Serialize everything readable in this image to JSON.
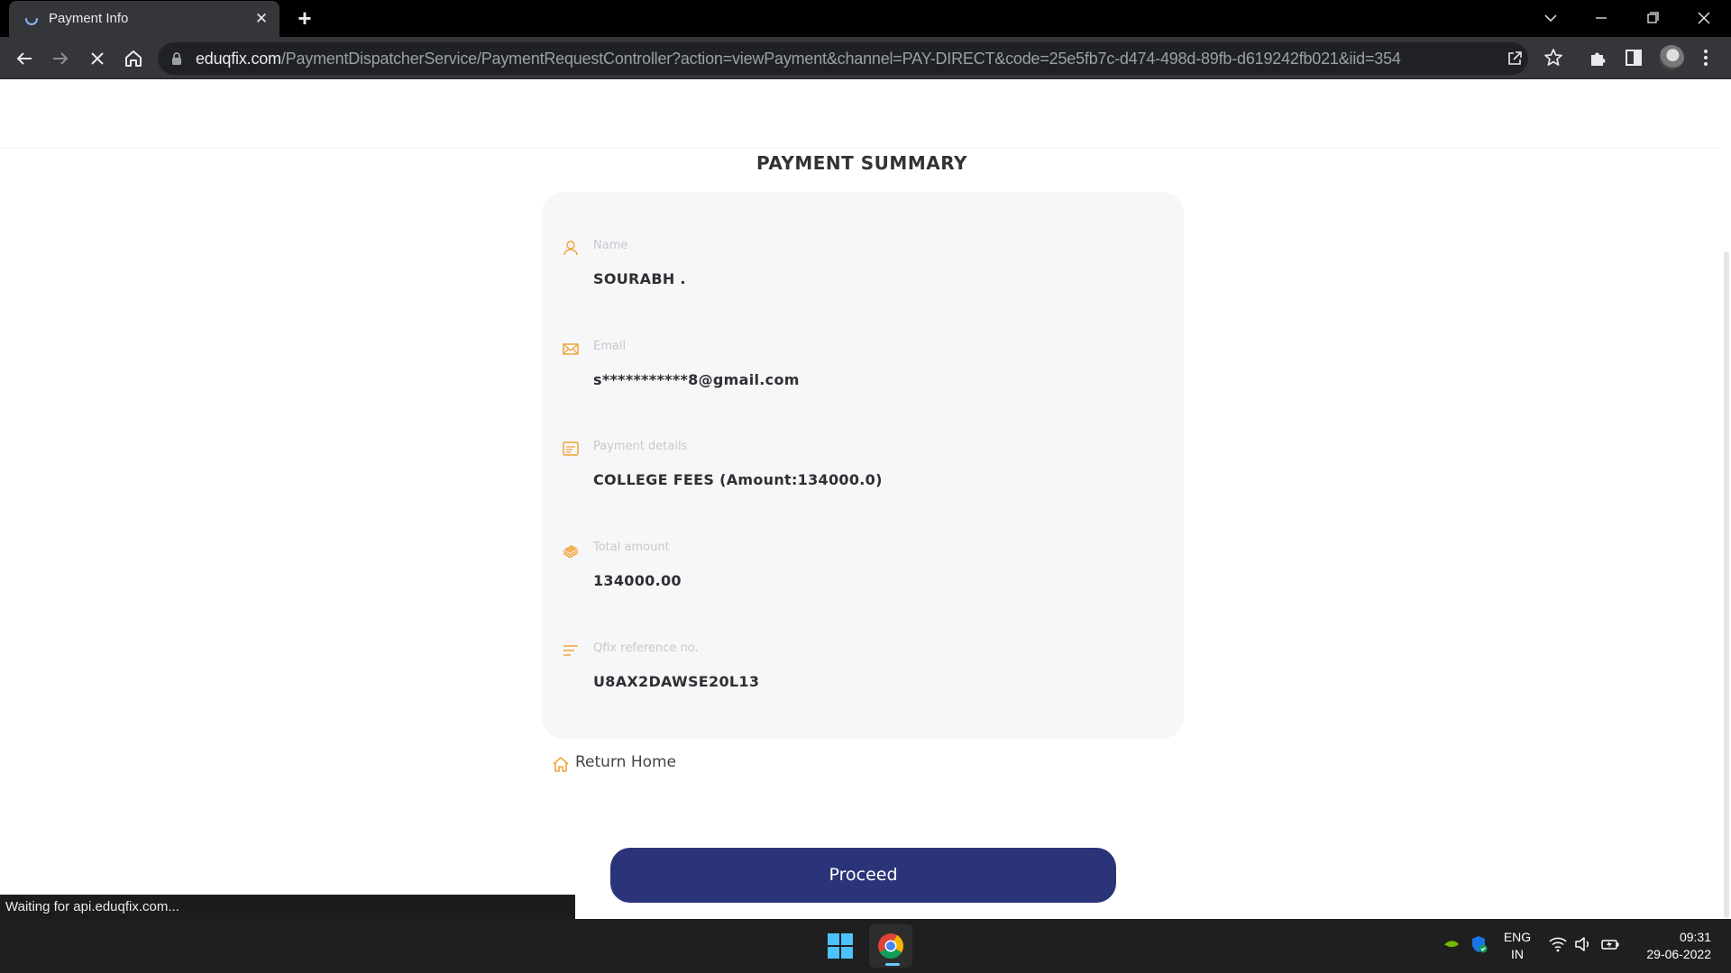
{
  "browser": {
    "tab_title": "Payment Info",
    "tab_close": "✕",
    "new_tab": "+",
    "url_host": "eduqfix.com",
    "url_path": "/PaymentDispatcherService/PaymentRequestController?action=viewPayment&channel=PAY-DIRECT&code=25e5fb7c-d474-498d-89fb-d619242fb021&iid=354",
    "status_text": "Waiting for api.eduqfix.com..."
  },
  "page": {
    "title": "PAYMENT SUMMARY",
    "fields": [
      {
        "label": "Name",
        "value": "SOURABH .",
        "icon": "user-icon"
      },
      {
        "label": "Email",
        "value": "s***********8@gmail.com",
        "icon": "mail-icon"
      },
      {
        "label": "Payment details",
        "value": "COLLEGE FEES (Amount:134000.0)",
        "icon": "details-icon"
      },
      {
        "label": "Total amount",
        "value": "134000.00",
        "icon": "money-icon"
      },
      {
        "label": "Qfix reference no.",
        "value": "U8AX2DAWSE20L13",
        "icon": "lines-icon"
      }
    ],
    "return_home": "Return Home",
    "proceed": "Proceed"
  },
  "taskbar": {
    "lang_top": "ENG",
    "lang_bottom": "IN",
    "time": "09:31",
    "date": "29-06-2022"
  },
  "colors": {
    "accent_icon": "#f0a43a",
    "proceed_bg": "#2c3479"
  }
}
